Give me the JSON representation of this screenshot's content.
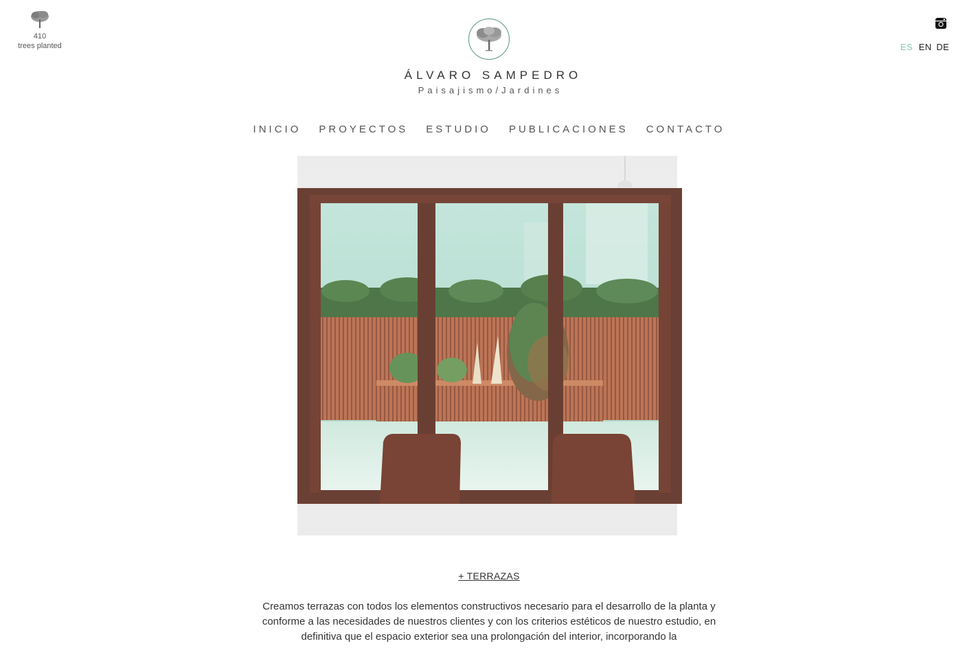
{
  "tree_counter": {
    "count": "410",
    "label": "trees planted",
    "icon": "tree-icon"
  },
  "social": {
    "instagram_icon": "instagram-icon"
  },
  "languages": {
    "active": "ES",
    "others": [
      "EN",
      "DE"
    ],
    "active_color": "#8cc7b9"
  },
  "brand": {
    "name": "ÁLVARO SAMPEDRO",
    "subtitle": "Paisajismo/Jardines",
    "logo_icon": "tree-logo-icon",
    "accent_color": "#5a9486"
  },
  "nav": {
    "items": [
      "INICIO",
      "PROYECTOS",
      "ESTUDIO",
      "PUBLICACIONES",
      "CONTACTO"
    ]
  },
  "hero": {
    "image": "terrace-through-glass-doors-photo"
  },
  "section": {
    "title": "+ TERRAZAS",
    "body": "Creamos terrazas con todos los elementos constructivos necesario para el desarrollo de la planta y conforme a las necesidades de nuestros clientes y con los criterios estéticos de nuestro estudio, en definitiva que el espacio exterior sea una prolongación del interior, incorporando la"
  }
}
